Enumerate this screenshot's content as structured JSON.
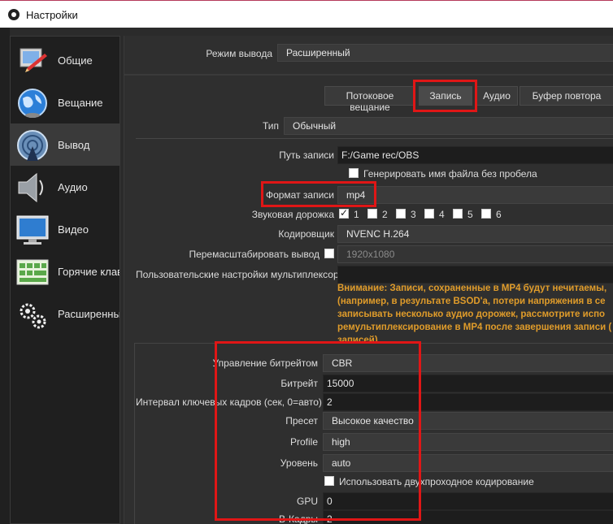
{
  "window": {
    "title": "Настройки"
  },
  "sidebar": {
    "items": [
      {
        "label": "Общие",
        "icon": "general-icon"
      },
      {
        "label": "Вещание",
        "icon": "stream-globe-icon"
      },
      {
        "label": "Вывод",
        "icon": "output-antenna-icon"
      },
      {
        "label": "Аудио",
        "icon": "speaker-icon"
      },
      {
        "label": "Видео",
        "icon": "monitor-icon"
      },
      {
        "label": "Горячие клави",
        "icon": "keyboard-icon"
      },
      {
        "label": "Расширенные",
        "icon": "gears-icon"
      }
    ],
    "active_index": 2
  },
  "output_mode": {
    "label": "Режим вывода",
    "value": "Расширенный"
  },
  "tabs": [
    {
      "label": "Потоковое вещание"
    },
    {
      "label": "Запись"
    },
    {
      "label": "Аудио"
    },
    {
      "label": "Буфер повтора"
    }
  ],
  "recording": {
    "type_label": "Тип",
    "type_value": "Обычный",
    "path_label": "Путь записи",
    "path_value": "F:/Game rec/OBS",
    "no_space_label": "Генерировать имя файла без пробела",
    "format_label": "Формат записи",
    "format_value": "mp4",
    "audio_track_label": "Звуковая дорожка",
    "tracks": [
      "1",
      "2",
      "3",
      "4",
      "5",
      "6"
    ],
    "encoder_label": "Кодировщик",
    "encoder_value": "NVENC H.264",
    "rescale_label": "Перемасштабировать вывод",
    "rescale_value": "1920x1080",
    "muxer_label": "Пользовательские настройки мультиплексора",
    "muxer_value": "",
    "warning_lines": [
      "Внимание: Записи, сохраненные в MP4 будут нечитаемы,",
      "(например, в результате BSOD'а, потери напряжения в се",
      "записывать несколько аудио дорожек, рассмотрите испо",
      "ремультиплексирование в MP4 после завершения записи (",
      "записей)"
    ]
  },
  "encoder_settings": {
    "rate_control_label": "Управление битрейтом",
    "rate_control_value": "CBR",
    "bitrate_label": "Битрейт",
    "bitrate_value": "15000",
    "keyframe_label": "Интервал ключевых кадров (сек, 0=авто)",
    "keyframe_value": "2",
    "preset_label": "Пресет",
    "preset_value": "Высокое качество",
    "profile_label": "Profile",
    "profile_value": "high",
    "level_label": "Уровень",
    "level_value": "auto",
    "two_pass_label": "Использовать двухпроходное кодирование",
    "gpu_label": "GPU",
    "gpu_value": "0",
    "bframes_label": "B-Кадры",
    "bframes_value": "2"
  },
  "colors": {
    "highlight": "#e01616",
    "warning": "#e09c2a",
    "background": "#2f2f2f"
  }
}
